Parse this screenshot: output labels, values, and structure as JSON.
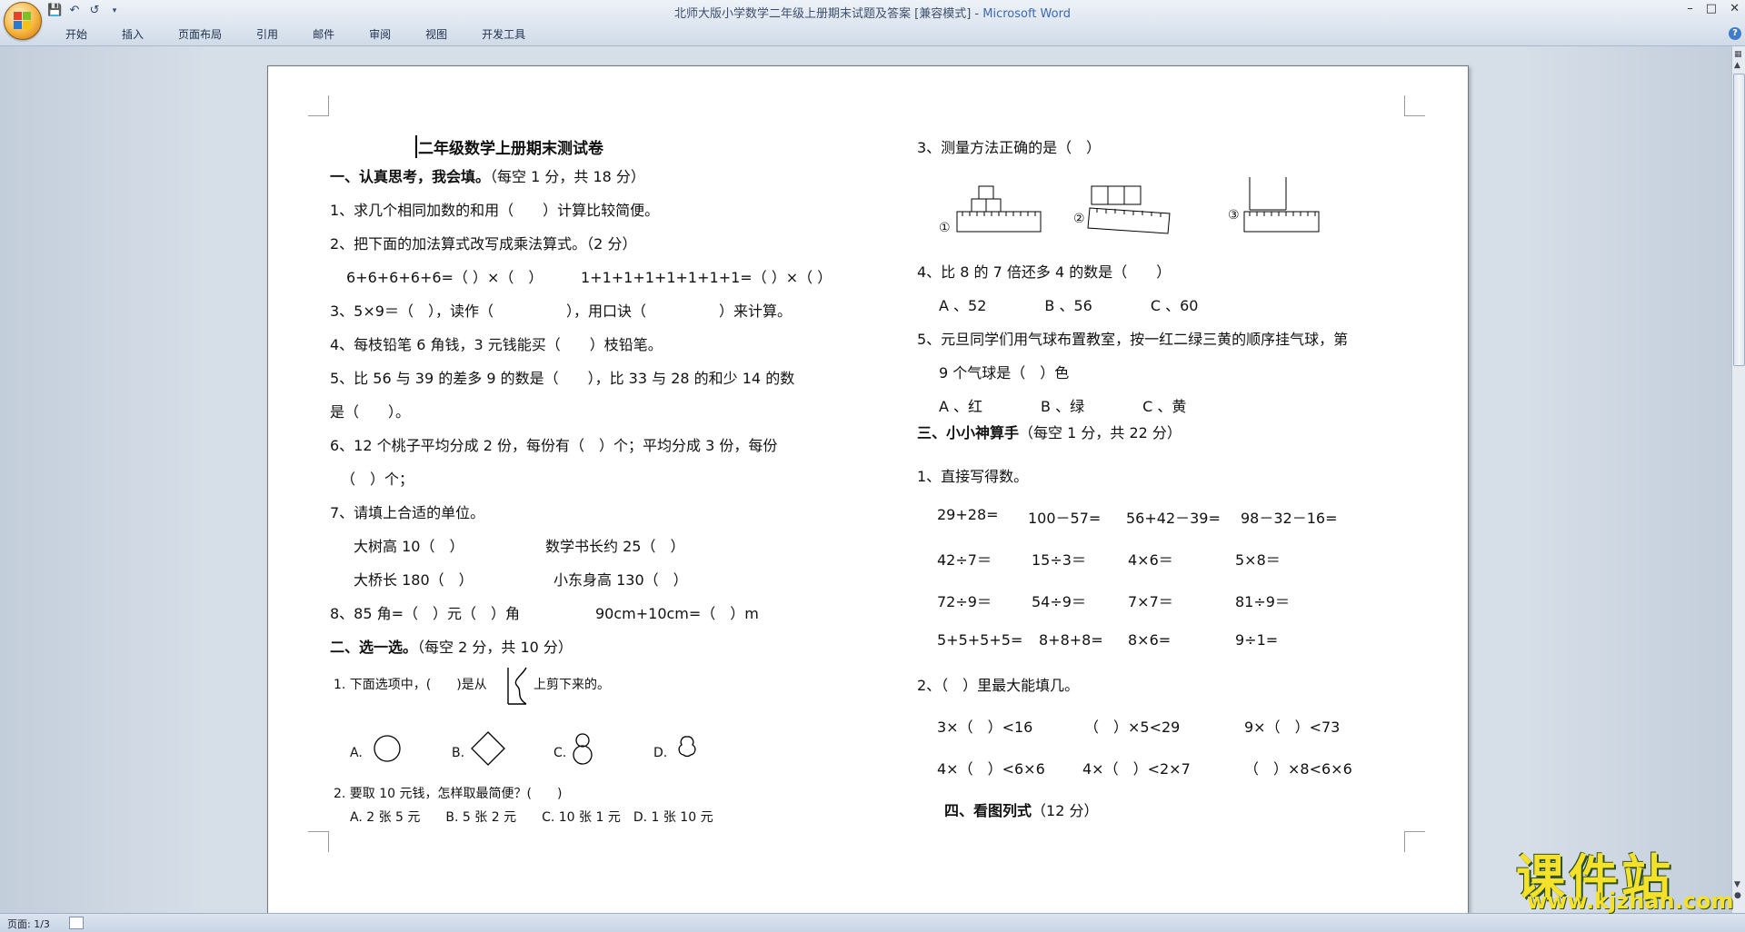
{
  "window": {
    "title": "北师大版小学数学二年级上册期末试题及答案 [兼容模式] - ",
    "app_name": "Microsoft Word"
  },
  "ribbon": {
    "tabs": [
      "开始",
      "插入",
      "页面布局",
      "引用",
      "邮件",
      "审阅",
      "视图",
      "开发工具"
    ]
  },
  "status_bar": {
    "page": "页面: 1/3"
  },
  "watermark": {
    "main": "课件站",
    "url": "www.kjzhan.com"
  },
  "doc": {
    "title": "二年级数学上册期末测试卷",
    "left": [
      {
        "id": "s1",
        "bold": "一、认真思考，我会填。",
        "text": "（每空 1 分，共 18 分）"
      },
      {
        "id": "q1",
        "text": "1、求几个相同加数的和用（　　）计算比较简便。"
      },
      {
        "id": "q2",
        "text": "2、把下面的加法算式改写成乘法算式。（2 分）"
      },
      {
        "id": "q2a",
        "text": "6+6+6+6+6=（ ）×（　）"
      },
      {
        "id": "q2b",
        "text": "1+1+1+1+1+1+1+1=（ ）×（ ）"
      },
      {
        "id": "q3",
        "text": "3、5×9＝（　），读作（　　　　　），用口诀（　　　　　）来计算。"
      },
      {
        "id": "q4",
        "text": "4、每枝铅笔 6 角钱，3 元钱能买（　　）枝铅笔。"
      },
      {
        "id": "q5",
        "text": "5、比 56 与 39 的差多 9 的数是（　　），比 33 与 28 的和少 14 的数"
      },
      {
        "id": "q5b",
        "text": "是（　　）。"
      },
      {
        "id": "q6",
        "text": "6、12 个桃子平均分成 2 份，每份有（　）个；平均分成 3 份，每份"
      },
      {
        "id": "q6b",
        "text": "（　）个；"
      },
      {
        "id": "q7",
        "text": "7、请填上合适的单位。"
      },
      {
        "id": "q7a",
        "text": "大树高 10（　）"
      },
      {
        "id": "q7b",
        "text": "数学书长约 25（　）"
      },
      {
        "id": "q7c",
        "text": "大桥长 180（　）"
      },
      {
        "id": "q7d",
        "text": "小东身高 130（　）"
      },
      {
        "id": "q8a",
        "text": "8、85 角=（　）元（　）角"
      },
      {
        "id": "q8b",
        "text": "90cm+10cm=（　）m"
      },
      {
        "id": "s2",
        "bold": "二、选一选。",
        "text": "（每空 2 分，共 10 分）"
      },
      {
        "id": "c1a",
        "text": "1. 下面选项中，(　　)是从"
      },
      {
        "id": "c1b",
        "text": "上剪下来的。"
      },
      {
        "id": "c2",
        "text": "2. 要取 10 元钱，怎样取最简便？(　　)"
      },
      {
        "id": "c2opt",
        "text": "A. 2 张 5 元　　B. 5 张 2 元　　C. 10 张 1 元　D. 1 张 10 元"
      }
    ],
    "choice_labels": [
      "A.",
      "B.",
      "C.",
      "D."
    ],
    "right": [
      {
        "id": "r3",
        "text": "3、测量方法正确的是（　）"
      },
      {
        "id": "r4",
        "text": "4、比 8 的 7 倍还多 4 的数是（　　）"
      },
      {
        "id": "r4opt",
        "text": "A 、52　　　　B 、56　　　　C 、60"
      },
      {
        "id": "r5",
        "text": "5、元旦同学们用气球布置教室，按一红二绿三黄的顺序挂气球，第"
      },
      {
        "id": "r5b",
        "text": "9 个气球是（　）色"
      },
      {
        "id": "r5opt",
        "text": "A 、红　　　　B 、绿　　　　C 、黄"
      },
      {
        "id": "s3",
        "bold": "三、小小神算手",
        "text": "（每空 1 分，共 22 分）"
      },
      {
        "id": "r31",
        "text": "1、直接写得数。"
      },
      {
        "id": "r32",
        "text": "2、（　）里最大能填几。"
      },
      {
        "id": "s4",
        "bold": "四、看图列式",
        "text": "（12 分）"
      }
    ],
    "ruler_labels": [
      "①",
      "②",
      "③"
    ],
    "calc_rows": [
      [
        "29+28=",
        "100－57=",
        "56+42－39=",
        "98－32－16="
      ],
      [
        "42÷7＝",
        "15÷3＝",
        "4×6＝",
        "5×8＝"
      ],
      [
        "72÷9＝",
        "54÷9＝",
        "7×7＝",
        "81÷9＝"
      ],
      [
        "5+5+5+5=",
        "8+8+8=",
        "8×6=",
        "9÷1="
      ]
    ],
    "fill_rows": [
      [
        "3×（　）<16",
        "（　）×5<29",
        "9×（　）<73"
      ],
      [
        "4×（　）<6×6",
        "4×（　）<2×7",
        "（　）×8<6×6"
      ]
    ]
  }
}
